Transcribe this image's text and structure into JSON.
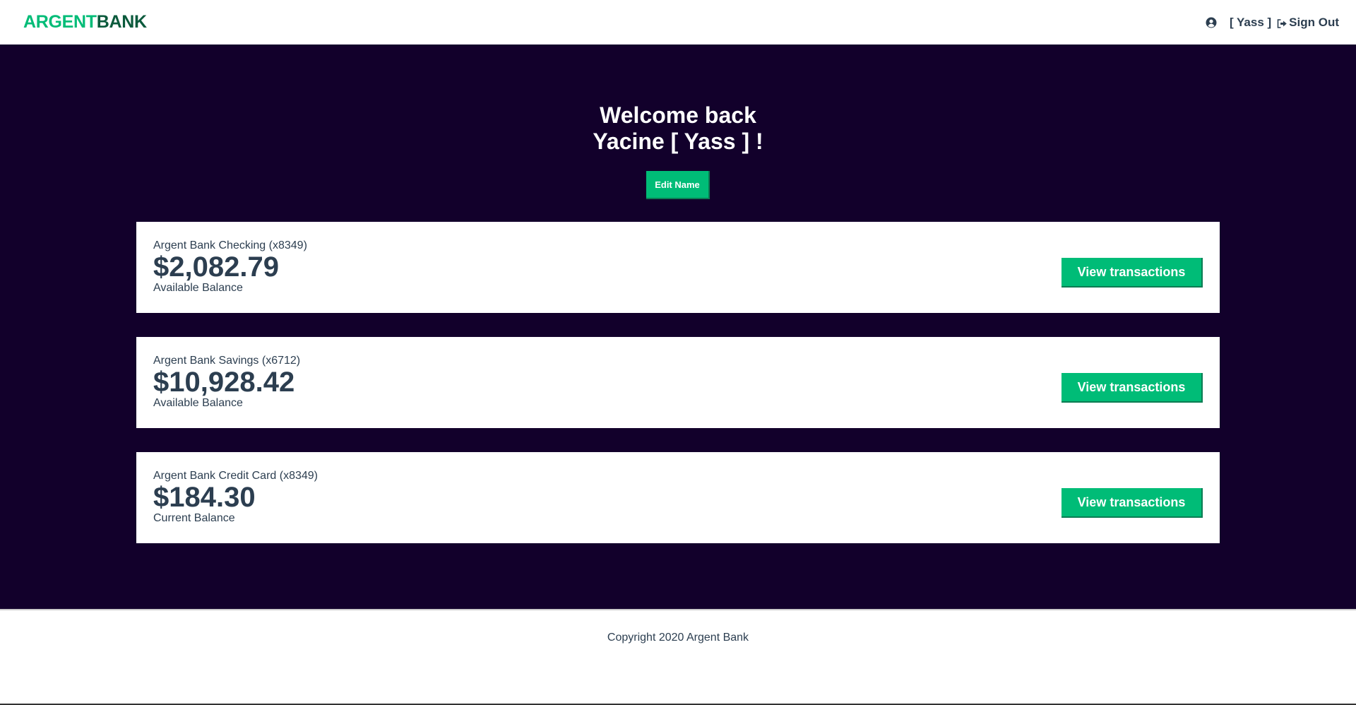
{
  "nav": {
    "logo_part1": "ARGENT",
    "logo_part2": "BANK",
    "username": "[ Yass ]",
    "signout_label": "Sign Out",
    "user_icon": "user-circle-icon",
    "signout_icon": "sign-out-icon"
  },
  "header": {
    "line1": "Welcome back",
    "line2": "Yacine [ Yass ] !",
    "edit_button": "Edit Name"
  },
  "accounts": [
    {
      "title": "Argent Bank Checking (x8349)",
      "amount": "$2,082.79",
      "description": "Available Balance",
      "button": "View transactions"
    },
    {
      "title": "Argent Bank Savings (x6712)",
      "amount": "$10,928.42",
      "description": "Available Balance",
      "button": "View transactions"
    },
    {
      "title": "Argent Bank Credit Card (x8349)",
      "amount": "$184.30",
      "description": "Current Balance",
      "button": "View transactions"
    }
  ],
  "footer": {
    "text": "Copyright 2020 Argent Bank"
  },
  "colors": {
    "accent": "#00bc77",
    "main_background": "#12002b",
    "text": "#2c3e50"
  }
}
